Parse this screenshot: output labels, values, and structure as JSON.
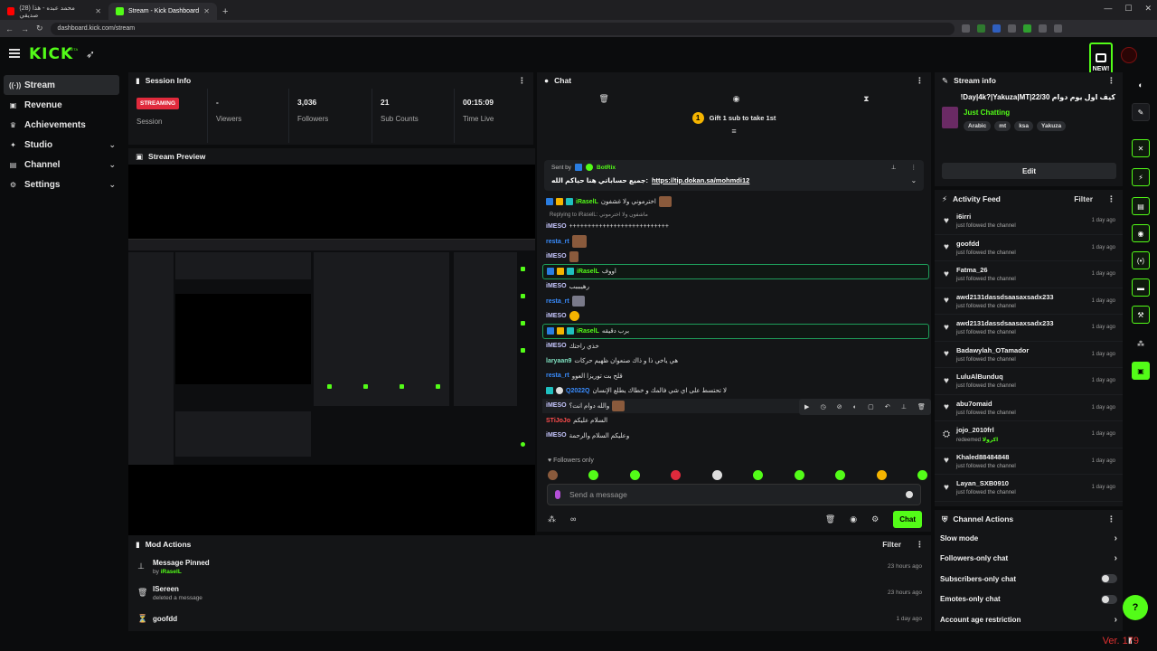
{
  "browser": {
    "tabs": [
      {
        "label": "(28) محمد عبده - هذا صديقي",
        "favicon_color": "#ff0000"
      },
      {
        "label": "Stream - Kick Dashboard",
        "favicon_color": "#53fc18"
      }
    ],
    "url": "dashboard.kick.com/stream"
  },
  "brand": {
    "logo": "KICK",
    "beta": "BETA",
    "new_label": "NEW!",
    "accent": "#53fc18"
  },
  "nav": {
    "items": [
      {
        "label": "Stream",
        "icon": "stream-icon"
      },
      {
        "label": "Revenue",
        "icon": "revenue-icon"
      },
      {
        "label": "Achievements",
        "icon": "trophy-icon"
      },
      {
        "label": "Studio",
        "icon": "studio-icon"
      },
      {
        "label": "Channel",
        "icon": "channel-icon"
      },
      {
        "label": "Settings",
        "icon": "gear-icon"
      }
    ]
  },
  "session": {
    "title": "Session Info",
    "status": "STREAMING",
    "session_label": "Session",
    "viewers_value": "-",
    "viewers_label": "Viewers",
    "followers_value": "3,036",
    "followers_label": "Followers",
    "subs_value": "21",
    "subs_label": "Sub Counts",
    "time_value": "00:15:09",
    "time_label": "Time Live"
  },
  "preview": {
    "title": "Stream Preview"
  },
  "chat": {
    "title": "Chat",
    "gift_num": "1",
    "gift_text": "Gift 1 sub to take 1st",
    "pinned_by_prefix": "Sent by",
    "pinned_by": "BotRix",
    "pinned_text": "جميع حساباتي هنا حياكم الله:",
    "pinned_link": "https://tip.dokan.sa/mohmdi12",
    "messages": [
      {
        "user": "iRaselL",
        "text": "اخترموني ولا غشفون",
        "hl": false
      },
      {
        "reply": "Replying to iRaselL: ماشفون ولا اخترموني"
      },
      {
        "user": "iMESO",
        "text": "+++++++++++++++++++++++++++",
        "hl": false
      },
      {
        "user": "resta_rt",
        "text": "",
        "hl": false
      },
      {
        "user": "iMESO",
        "text": "",
        "hl": false
      },
      {
        "user": "iRaselL",
        "text": "اووف",
        "hl": true
      },
      {
        "user": "iMESO",
        "text": "رهيبببب",
        "hl": false
      },
      {
        "user": "resta_rt",
        "text": "",
        "hl": false
      },
      {
        "user": "iMESO",
        "text": "",
        "hl": false
      },
      {
        "user": "iRaselL",
        "text": "برب دقيقه",
        "hl": true
      },
      {
        "user": "iMESO",
        "text": "خذي راحتك",
        "hl": false
      },
      {
        "user": "laryaan9",
        "text": "هي ياخي ذا و ذاك صنعوان ظهيم حركات",
        "hl": false
      },
      {
        "user": "resta_rt",
        "text": "قلح بت توريزا العوو",
        "hl": false
      },
      {
        "user": "Q2022Q",
        "text": "لا تحتسط على اي شي فالمك و خطاك يطلع الإنسان",
        "hl": false
      },
      {
        "user": "iMESO",
        "text": "والله دوام انت؟",
        "hl": false
      },
      {
        "user": "STiJoJo",
        "text": "السلام عليكم",
        "hl": false
      },
      {
        "user": "iMESO",
        "text": "وعليكم السلام والرحمة",
        "hl": false
      }
    ],
    "followers_only": "Followers only",
    "placeholder": "Send a message",
    "send_label": "Chat",
    "footer_icon": "∞"
  },
  "stream_info": {
    "title": "Stream info",
    "stream_title": "كيف اول يوم دوام 22/30|Day|4k?|Yakuza|MT!",
    "category": "Just Chatting",
    "tags": [
      "Arabic",
      "mt",
      "ksa",
      "Yakuza"
    ],
    "edit_label": "Edit"
  },
  "activity": {
    "title": "Activity Feed",
    "filter_label": "Filter",
    "items": [
      {
        "user": "i6irri",
        "action": "just followed the channel",
        "time": "1 day ago"
      },
      {
        "user": "goofdd",
        "action": "just followed the channel",
        "time": "1 day ago"
      },
      {
        "user": "Fatma_26",
        "action": "just followed the channel",
        "time": "1 day ago"
      },
      {
        "user": "awd2131dassdsaasaxsadx233",
        "action": "just followed the channel",
        "time": "1 day ago"
      },
      {
        "user": "awd2131dassdsaasaxsadx233",
        "action": "just followed the channel",
        "time": "1 day ago"
      },
      {
        "user": "Badawylah_OTamador",
        "action": "just followed the channel",
        "time": "1 day ago"
      },
      {
        "user": "LuluAlBunduq",
        "action": "just followed the channel",
        "time": "1 day ago"
      },
      {
        "user": "abu7omaid",
        "action": "just followed the channel",
        "time": "1 day ago"
      },
      {
        "user": "jojo_2010frl",
        "action": "redeemed",
        "reward": "اكرولا",
        "time": "1 day ago"
      },
      {
        "user": "Khaled88484848",
        "action": "just followed the channel",
        "time": "1 day ago"
      },
      {
        "user": "Layan_SXB0910",
        "action": "just followed the channel",
        "time": "1 day ago"
      }
    ]
  },
  "channel_actions": {
    "title": "Channel Actions",
    "items": [
      {
        "label": "Slow mode",
        "control": "chevron"
      },
      {
        "label": "Followers-only chat",
        "control": "chevron"
      },
      {
        "label": "Subscribers-only chat",
        "control": "toggle"
      },
      {
        "label": "Emotes-only chat",
        "control": "toggle"
      },
      {
        "label": "Account age restriction",
        "control": "chevron"
      }
    ]
  },
  "mod_actions": {
    "title": "Mod Actions",
    "filter_label": "Filter",
    "items": [
      {
        "title": "Message Pinned",
        "sub_prefix": "by",
        "sub_user": "iRaselL",
        "time": "23 hours ago",
        "icon": "pin-icon"
      },
      {
        "title": "lSereen",
        "sub_prefix": "deleted a message",
        "sub_user": "",
        "time": "23 hours ago",
        "icon": "trash-icon"
      },
      {
        "title": "goofdd",
        "sub_prefix": "",
        "sub_user": "",
        "time": "1 day ago",
        "icon": "filter-icon"
      }
    ]
  },
  "footer": {
    "version": "Ver. 179"
  }
}
